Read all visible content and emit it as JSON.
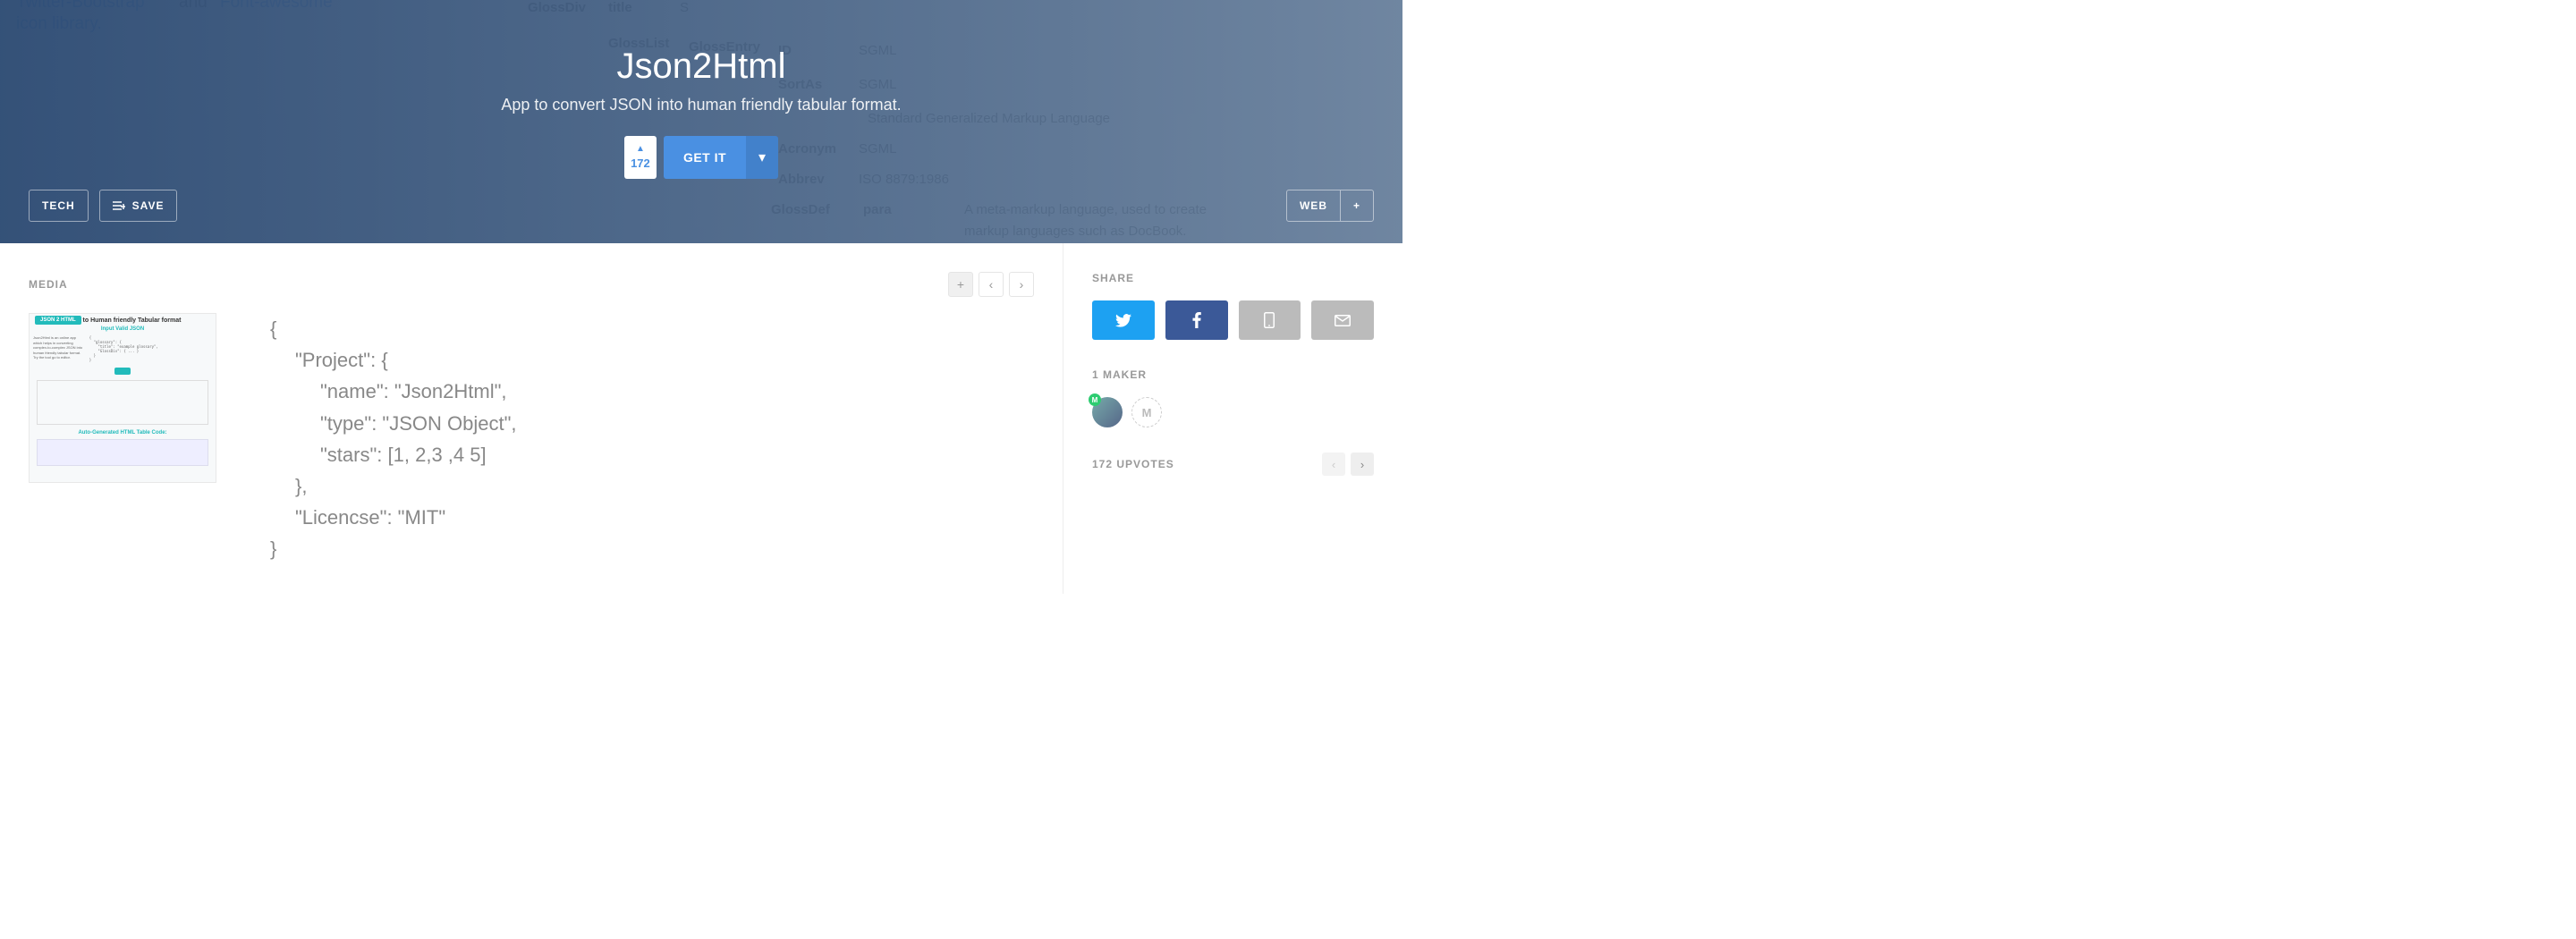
{
  "hero": {
    "title": "Json2Html",
    "subtitle": "App to convert JSON into human friendly tabular format.",
    "upvote_count": "172",
    "get_it_label": "GET IT",
    "left_buttons": {
      "tech": "TECH",
      "save": "SAVE"
    },
    "right_buttons": {
      "web": "WEB"
    },
    "bg_text": {
      "line1a": "Twitter-Bootstrap",
      "line1b": "and",
      "line1c": "Font-awesome",
      "line2": "icon library.",
      "tbl": {
        "glossdiv": "GlossDiv",
        "title_k": "title",
        "title_v": "S",
        "glosslist": "GlossList",
        "glossentry": "GlossEntry",
        "id_k": "ID",
        "id_v": "SGML",
        "sortas_k": "SortAs",
        "sortas_v": "SGML",
        "glossterm_v": "Standard Generalized Markup Language",
        "acronym_k": "Acronym",
        "acronym_v": "SGML",
        "abbrev_k": "Abbrev",
        "abbrev_v": "ISO 8879:1986",
        "glossdef_k": "GlossDef",
        "para_k": "para",
        "para_v1": "A meta-markup language, used to create",
        "para_v2": "markup languages such as DocBook."
      }
    }
  },
  "media": {
    "label": "MEDIA",
    "thumb": {
      "badge": "JSON 2 HTML",
      "header": "JSON to Human friendly Tabular format",
      "sub": "Input Valid JSON",
      "footer": "Auto-Generated HTML Table Code:"
    },
    "preview_lines": {
      "l0": "{",
      "l1": "\"Project\": {",
      "l2": "\"name\": \"Json2Html\",",
      "l3": "\"type\": \"JSON Object\",",
      "l4": "\"stars\": [1, 2,3 ,4 5]",
      "l5": "},",
      "l6": "\"Licencse\": \"MIT\"",
      "l7": "}"
    }
  },
  "sidebar": {
    "share_label": "SHARE",
    "maker_label": "1 MAKER",
    "maker_add_label": "M",
    "maker_badge": "M",
    "upvotes_label": "172 UPVOTES"
  }
}
